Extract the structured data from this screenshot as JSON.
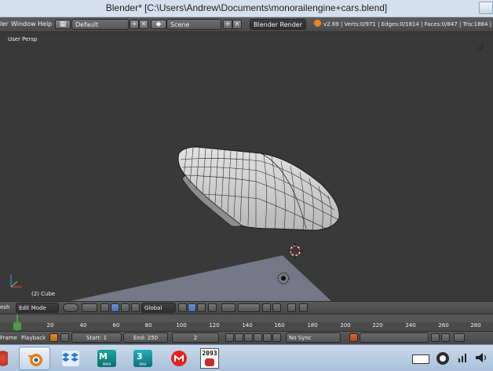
{
  "window": {
    "title": "Blender* [C:\\Users\\Andrew\\Documents\\monorailengine+cars.blend]"
  },
  "info_header": {
    "menus": [
      "ler",
      "Window",
      "Help"
    ],
    "screen_layout": "Default",
    "scene": "Scene",
    "render_engine": "Blender Render",
    "stats": "v2.69 | Verts:0/971 | Edges:0/1814 | Faces:0/847 | Tris:1884 | Mem:"
  },
  "viewport": {
    "view_name": "User Persp",
    "object_label": "(2) Cube"
  },
  "view3d_header": {
    "mode_menu": "esh",
    "mode": "Edit Mode",
    "orientation": "Global"
  },
  "timeline": {
    "ruler_ticks": [
      "0",
      "20",
      "40",
      "60",
      "80",
      "100",
      "120",
      "140",
      "160",
      "180",
      "200",
      "220",
      "240",
      "260",
      "280"
    ],
    "current_frame_marker": "0"
  },
  "timeline_header": {
    "frame_menu": "Frame",
    "playback_menu": "Playback",
    "start": "Start: 1",
    "end": "End: 250",
    "current_frame": "2",
    "sync": "No Sync"
  },
  "taskbar": {
    "apps": [
      "blender-icon",
      "dropbox-icon",
      "maya-icon",
      "3dsmax-icon",
      "makerbot-icon",
      "2093-icon"
    ],
    "maya_label": "MAYA",
    "max_label": "MAX",
    "game_label": "2093"
  }
}
